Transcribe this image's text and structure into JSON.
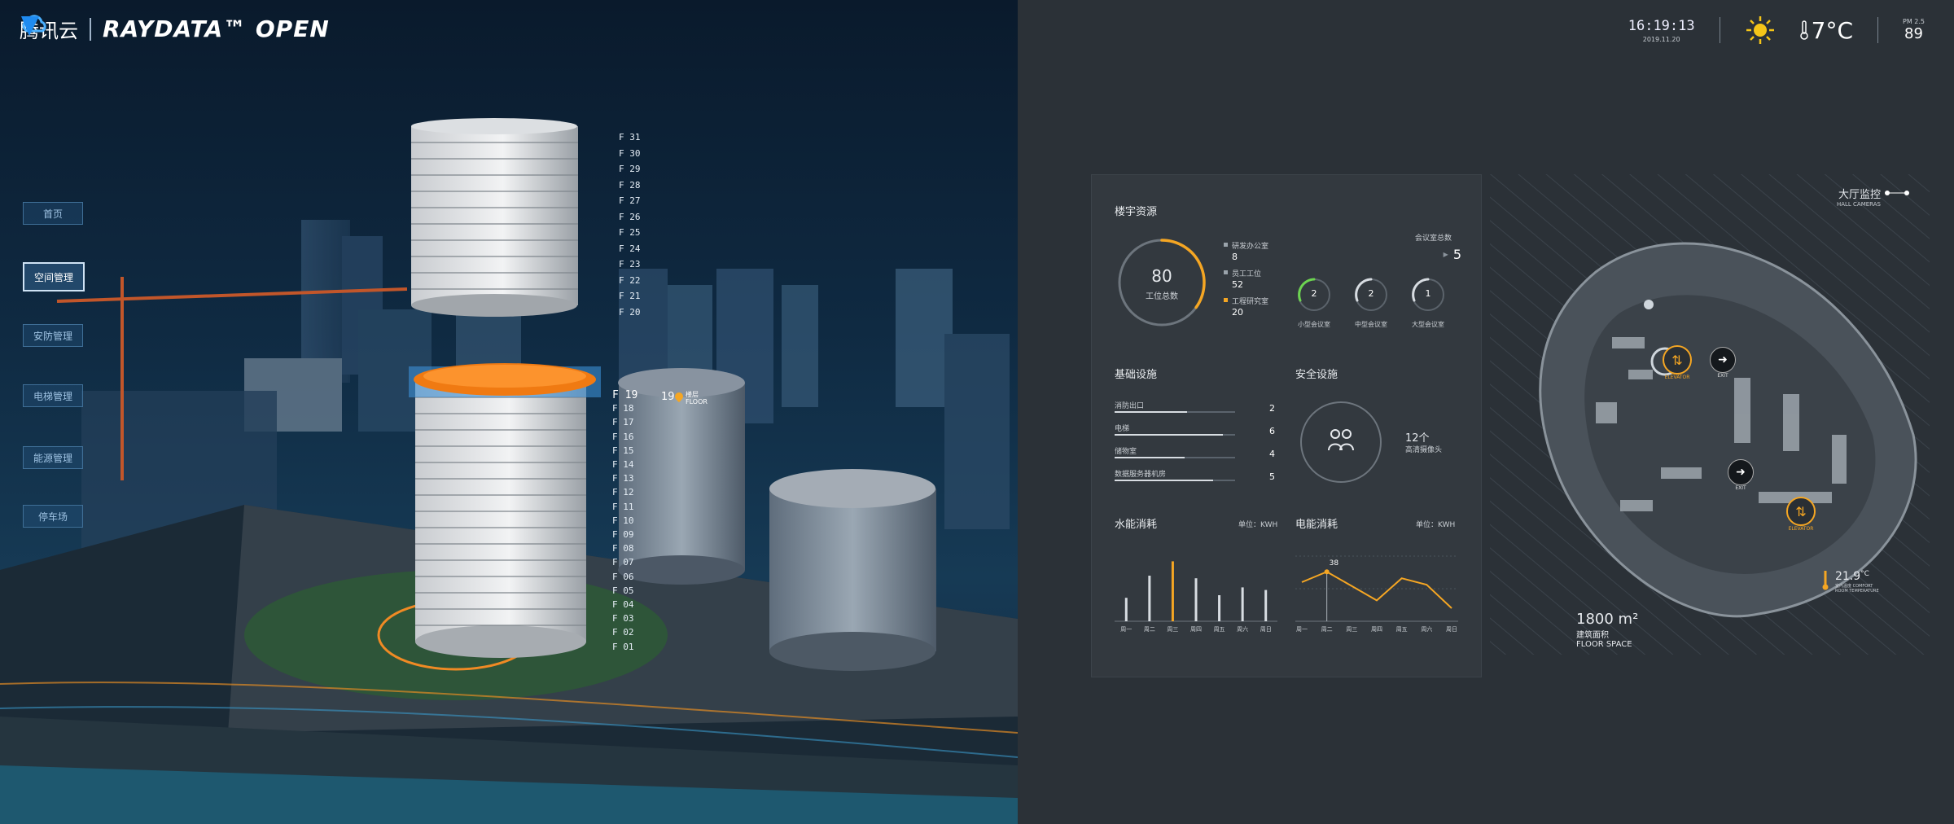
{
  "brand": {
    "tencent": "腾讯云",
    "product": "RAYDATA™ OPEN"
  },
  "nav": [
    "首页",
    "空间管理",
    "安防管理",
    "电梯管理",
    "能源管理",
    "停车场"
  ],
  "floors": [
    "F 31",
    "F 30",
    "F 29",
    "F 28",
    "F 27",
    "F 26",
    "F 25",
    "F 24",
    "F 23",
    "F 22",
    "F 21",
    "F 20",
    "F 19",
    "F 18",
    "F 17",
    "F 16",
    "F 15",
    "F 14",
    "F 13",
    "F 12",
    "F 11",
    "F 10",
    "F 09",
    "F 08",
    "F 07",
    "F 06",
    "F 05",
    "F 04",
    "F 03",
    "F 02",
    "F 01"
  ],
  "selected_floor": {
    "number": "19",
    "label": "楼层",
    "sub": "FLOOR"
  },
  "header": {
    "time": "16:19:13",
    "date": "2019.11.20",
    "temperature": "7°C",
    "pm_label": "PM 2.5",
    "pm_value": "89"
  },
  "office": {
    "title": "楼宇资源",
    "gauge_value": "80",
    "gauge_label": "工位总数",
    "gauge_fraction": 0.35,
    "legend": [
      {
        "label": "研发办公室",
        "value": "8",
        "color": "#9aa3ab"
      },
      {
        "label": "员工工位",
        "value": "52",
        "color": "#9aa3ab"
      },
      {
        "label": "工程研究室",
        "value": "20",
        "color": "#f5a623"
      }
    ],
    "meeting_total_label": "会议室总数",
    "meeting_total": "5",
    "rooms": [
      {
        "value": "2",
        "label": "小型会议室",
        "color": "#6cd450"
      },
      {
        "value": "2",
        "label": "中型会议室",
        "color": "#d7dce1"
      },
      {
        "value": "1",
        "label": "大型会议室",
        "color": "#d7dce1"
      }
    ]
  },
  "infra": {
    "title": "基础设施",
    "items": [
      {
        "label": "消防出口",
        "value": "2",
        "frac": 0.6
      },
      {
        "label": "电梯",
        "value": "6",
        "frac": 0.9
      },
      {
        "label": "储物室",
        "value": "4",
        "frac": 0.58
      },
      {
        "label": "数据服务器机房",
        "value": "5",
        "frac": 0.82
      }
    ]
  },
  "security": {
    "title": "安全设施",
    "count": "12个",
    "desc": "高清摄像头"
  },
  "water": {
    "title": "水能消耗",
    "unit": "单位：KWH"
  },
  "power": {
    "title": "电能消耗",
    "unit": "单位：KWH",
    "peak_label": "38"
  },
  "map": {
    "title": "大厅监控",
    "sub": "HALL CAMERAS",
    "elevator": "ELEVATOR",
    "exit": "EXIT",
    "temp": "21.9",
    "temp_unit": "°C",
    "temp_sub": "室内温度 COMFORT ROOM TEMPERATURE",
    "area": "1800 m²",
    "area_cn": "建筑面积",
    "area_en": "FLOOR SPACE"
  },
  "chart_data": [
    {
      "type": "bar",
      "title": "水能消耗",
      "unit": "单位：KWH",
      "categories": [
        "周一",
        "周二",
        "周三",
        "周四",
        "周五",
        "周六",
        "周日"
      ],
      "values": [
        18,
        35,
        46,
        33,
        20,
        26,
        24
      ],
      "highlight_index": 2
    },
    {
      "type": "line",
      "title": "电能消耗",
      "unit": "单位：KWH",
      "categories": [
        "周一",
        "周二",
        "周三",
        "周四",
        "周五",
        "周六",
        "周日"
      ],
      "values": [
        30,
        38,
        27,
        16,
        33,
        28,
        10
      ],
      "ylim": [
        0,
        50
      ]
    }
  ]
}
